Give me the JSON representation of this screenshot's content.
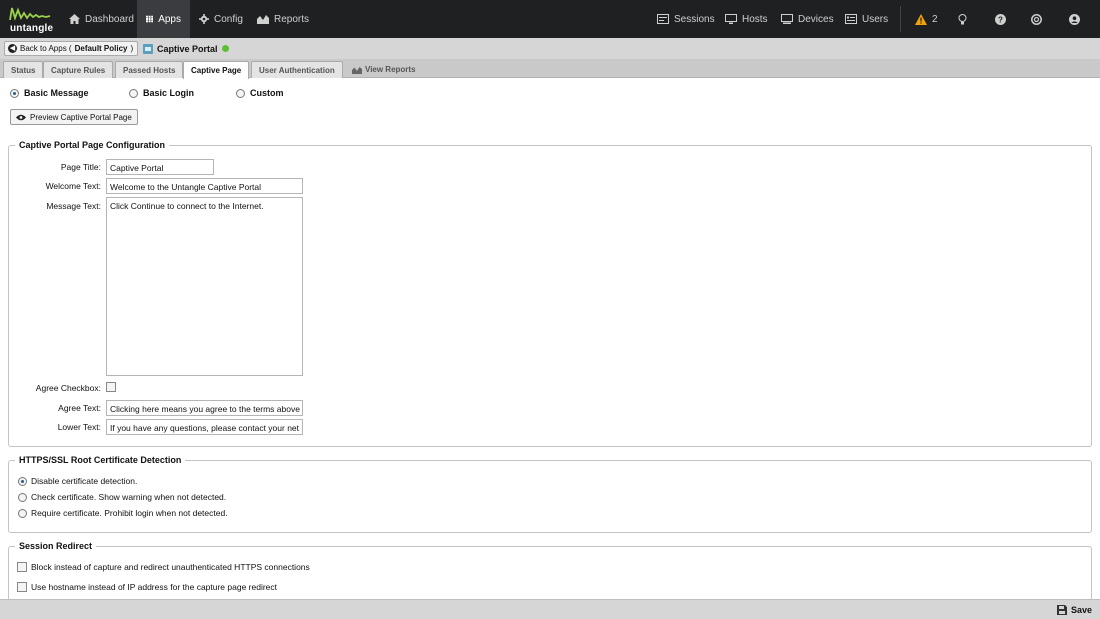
{
  "nav": {
    "logo_text": "untangle",
    "items": [
      {
        "label": "Dashboard",
        "icon": "home-icon"
      },
      {
        "label": "Apps",
        "icon": "grid-icon"
      },
      {
        "label": "Config",
        "icon": "gear-icon"
      },
      {
        "label": "Reports",
        "icon": "area-chart-icon"
      }
    ],
    "right_items": [
      {
        "label": "Sessions",
        "icon": "sessions-icon"
      },
      {
        "label": "Hosts",
        "icon": "hosts-icon"
      },
      {
        "label": "Devices",
        "icon": "devices-icon"
      },
      {
        "label": "Users",
        "icon": "users-icon"
      }
    ],
    "alert_count": "2"
  },
  "breadcrumb": {
    "back_prefix": "Back to Apps (",
    "policy": "Default Policy",
    "back_suffix": ")",
    "app_title": "Captive Portal"
  },
  "tabs": [
    "Status",
    "Capture Rules",
    "Passed Hosts",
    "Captive Page",
    "User Authentication",
    "View Reports"
  ],
  "page_modes": {
    "options": [
      "Basic Message",
      "Basic Login",
      "Custom"
    ],
    "selected": "Basic Message",
    "preview_label": "Preview Captive Portal Page"
  },
  "config": {
    "legend": "Captive Portal Page Configuration",
    "page_title_label": "Page Title:",
    "page_title_value": "Captive Portal",
    "welcome_label": "Welcome Text:",
    "welcome_value": "Welcome to the Untangle Captive Portal",
    "message_label": "Message Text:",
    "message_value": "Click Continue to connect to the Internet.",
    "agree_checkbox_label": "Agree Checkbox:",
    "agree_text_label": "Agree Text:",
    "agree_text_value": "Clicking here means you agree to the terms above",
    "lower_text_label": "Lower Text:",
    "lower_text_value": "If you have any questions, please contact your net"
  },
  "https": {
    "legend": "HTTPS/SSL Root Certificate Detection",
    "options": [
      "Disable certificate detection.",
      "Check certificate. Show warning when not detected.",
      "Require certificate. Prohibit login when not detected."
    ],
    "selected": "Disable certificate detection."
  },
  "redirect": {
    "legend": "Session Redirect",
    "options": [
      "Block instead of capture and redirect unauthenticated HTTPS connections",
      "Use hostname instead of IP address for the capture page redirect"
    ]
  },
  "footer": {
    "save_label": "Save"
  },
  "colors": {
    "status_online": "#5cbf36",
    "alert": "#f2a20c",
    "nav_bg": "#1f2022"
  }
}
